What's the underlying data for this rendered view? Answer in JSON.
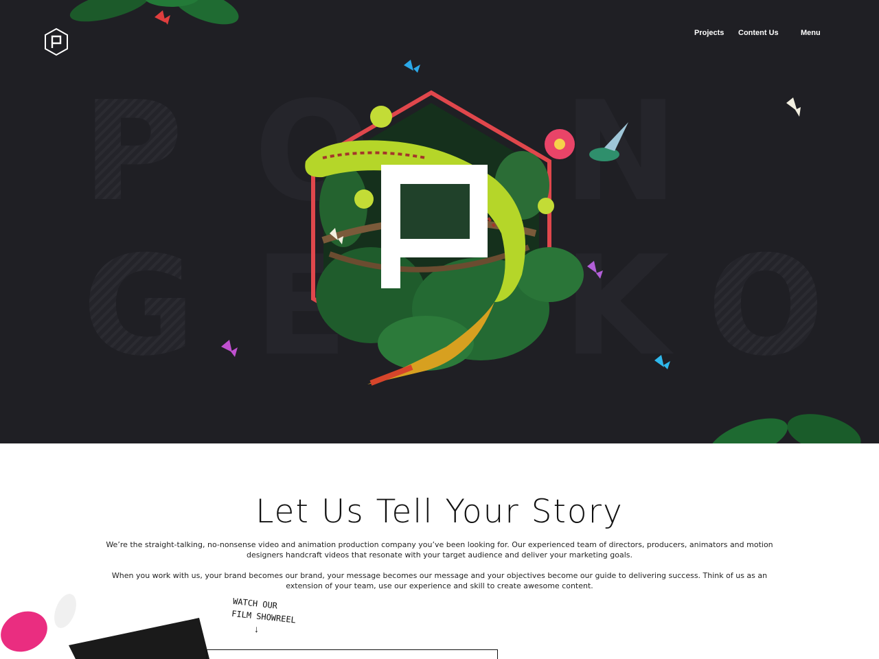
{
  "nav": {
    "items": [
      {
        "label": "Projects"
      },
      {
        "label": "Content Us"
      },
      {
        "label": "Menu"
      }
    ]
  },
  "hero": {
    "background_color": "#1f1f24",
    "accent_color": "#e0474c",
    "background_letters": [
      "P",
      "O",
      "N",
      "G",
      "E",
      "K",
      "O"
    ]
  },
  "story": {
    "title": "Let Us Tell Your Story",
    "paragraph1": "We’re the straight-talking, no-nonsense video and animation production company you’ve been looking for. Our experienced team of directors, producers, animators and motion designers handcraft videos that resonate with your target audience and deliver your marketing goals.",
    "paragraph2": "When you work with us, your brand becomes our brand, your message becomes our message and your objectives become our guide to delivering success. Think of us as an extension of your team, use our experience and skill to create awesome content.",
    "showreel_note_line1": "Watch our",
    "showreel_note_line2": "film showreel",
    "showreel_arrow": "↓"
  }
}
